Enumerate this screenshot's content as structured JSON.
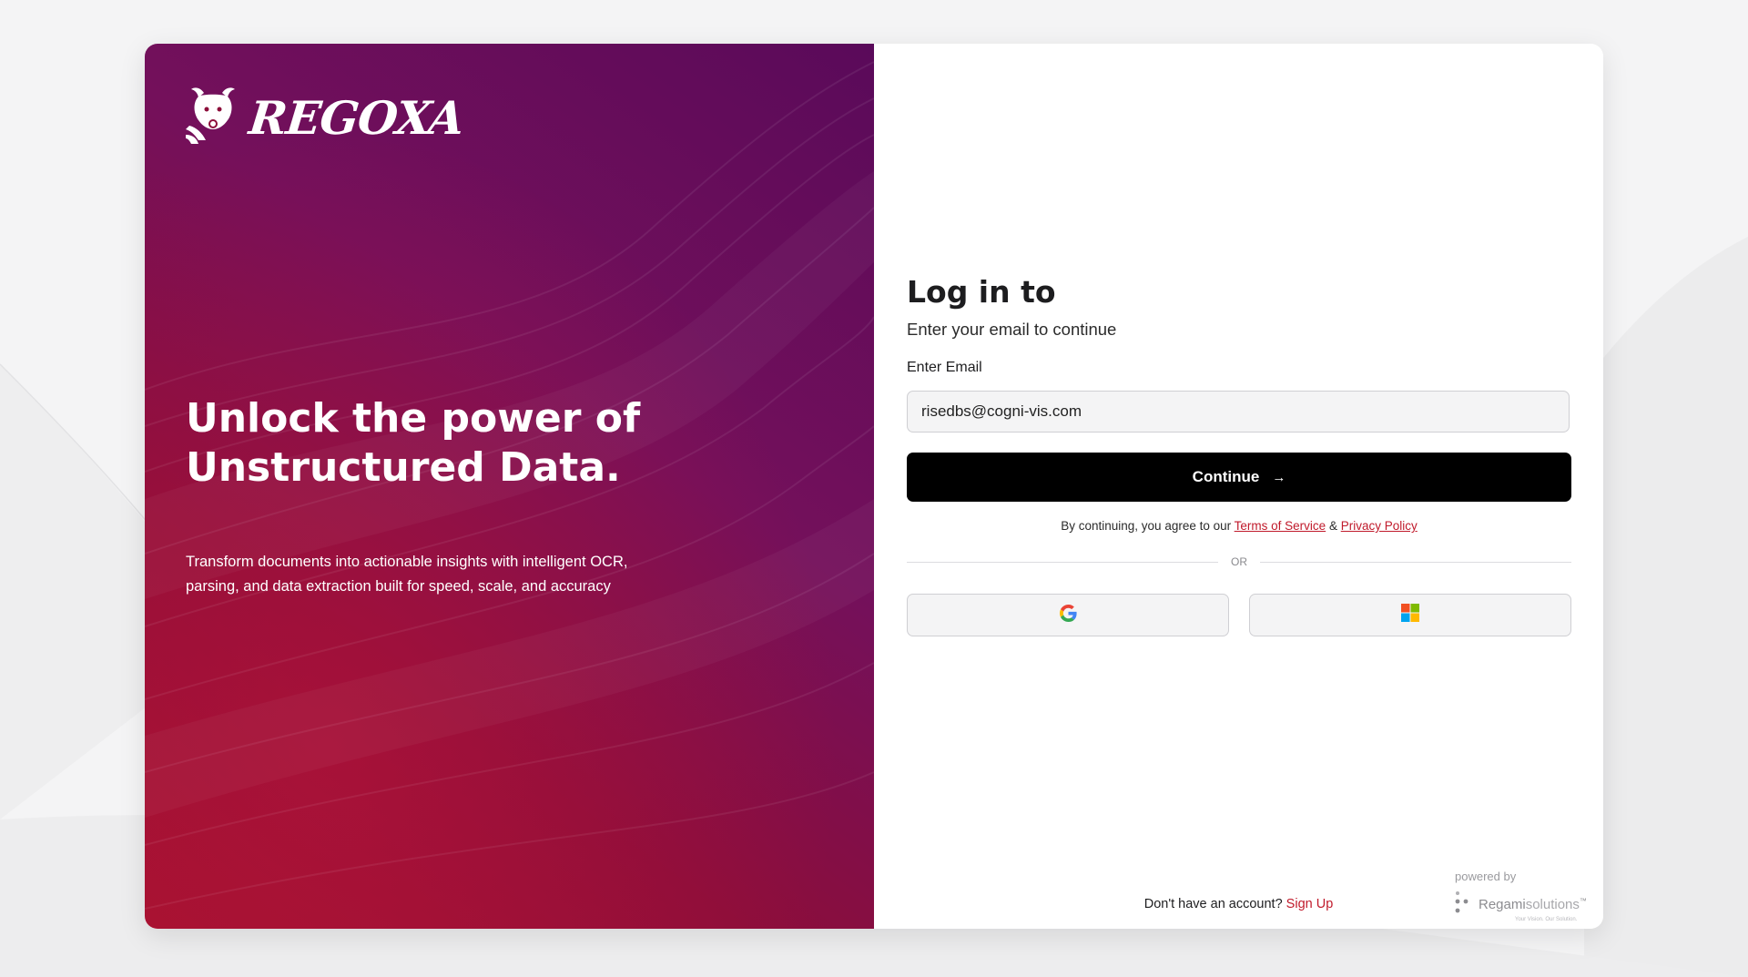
{
  "brand": {
    "logo_text": "REGOXA",
    "logo_icon": "bull-icon"
  },
  "hero": {
    "title_line1": "Unlock the power of",
    "title_line2": "Unstructured Data.",
    "subtitle_line1": "Transform documents into actionable insights with intelligent OCR,",
    "subtitle_line2": "parsing, and data extraction built for speed, scale, and accuracy"
  },
  "form": {
    "title": "Log in to",
    "subtitle": "Enter your email to continue",
    "email_label": "Enter Email",
    "email_value": "risedbs@cogni-vis.com",
    "continue_label": "Continue",
    "continue_icon": "arrow-right-icon",
    "terms_prefix": "By continuing, you agree to our",
    "terms_link": "Terms of Service",
    "terms_amp": "&",
    "privacy_link": "Privacy Policy",
    "divider_text": "OR",
    "social": [
      {
        "provider": "google",
        "icon": "google-icon"
      },
      {
        "provider": "microsoft",
        "icon": "microsoft-icon"
      }
    ],
    "signup_prompt": "Don't have an account?",
    "signup_link": "Sign Up"
  },
  "footer": {
    "powered_by": "powered by",
    "vendor_name_bold": "Regami",
    "vendor_name_light": "solutions",
    "vendor_tm": "™",
    "vendor_tagline": "Your Vision. Our Solution."
  },
  "colors": {
    "accent_red": "#c01a2b",
    "hero_start": "#a3112e",
    "hero_end": "#5a0a5a",
    "button_bg": "#000000"
  }
}
